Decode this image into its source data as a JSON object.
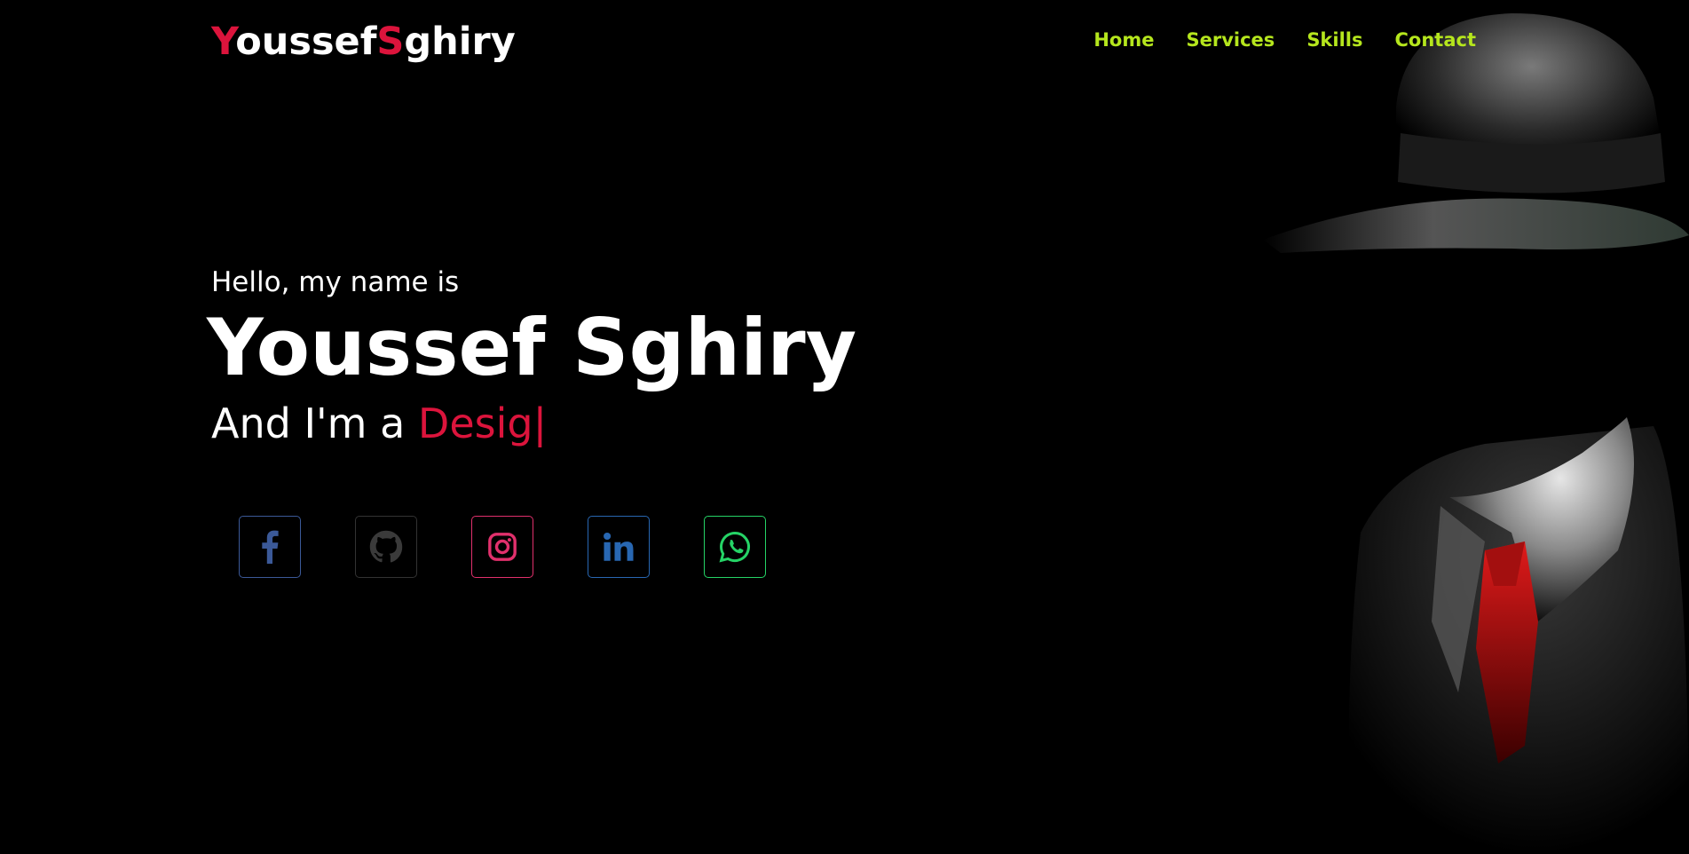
{
  "brand": {
    "first_initial": "Y",
    "first_rest": "oussef",
    "last_initial": "S",
    "last_rest": "ghiry"
  },
  "nav": {
    "items": [
      {
        "label": "Home"
      },
      {
        "label": "Services"
      },
      {
        "label": "Skills"
      },
      {
        "label": "Contact"
      }
    ]
  },
  "hero": {
    "greeting": "Hello, my name is",
    "name": "Youssef Sghiry",
    "role_prefix": "And I'm a ",
    "role_typed": "Desig",
    "caret": "|"
  },
  "socials": [
    {
      "icon": "facebook-icon",
      "color": "#3b5998"
    },
    {
      "icon": "github-icon",
      "color": "#333333"
    },
    {
      "icon": "instagram-icon",
      "color": "#e1306c"
    },
    {
      "icon": "linkedin-icon",
      "color": "#2867b2"
    },
    {
      "icon": "whatsapp-icon",
      "color": "#25d366"
    }
  ],
  "colors": {
    "background": "#000000",
    "accent": "#dc143c",
    "nav": "#b5e61d"
  }
}
